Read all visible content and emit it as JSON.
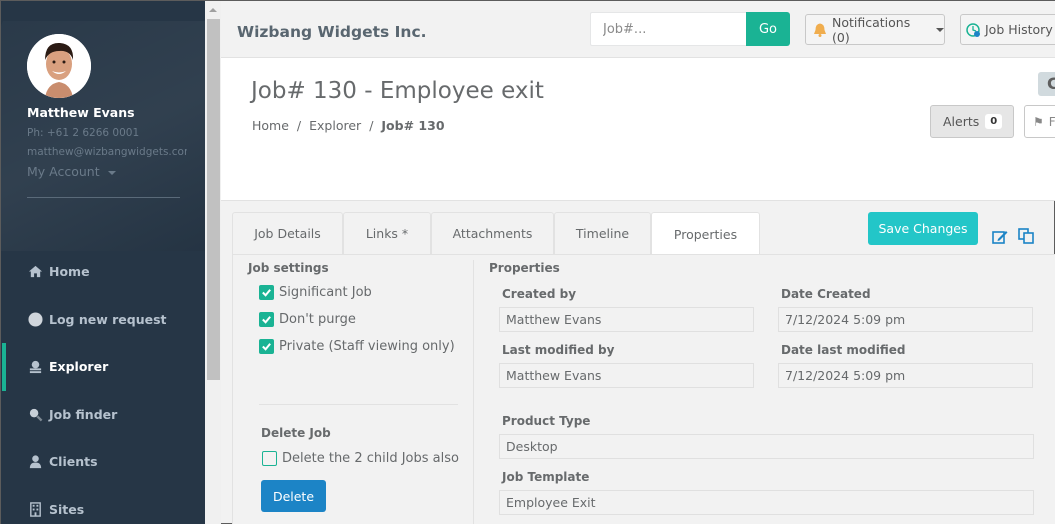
{
  "user": {
    "name": "Matthew Evans",
    "phone": "Ph: +61 2 6266 0001",
    "email": "matthew@wizbangwidgets.com",
    "account_menu": "My Account"
  },
  "sidebar": {
    "items": [
      {
        "label": "Home",
        "icon": "home-icon"
      },
      {
        "label": "Log new request",
        "icon": "circle-icon"
      },
      {
        "label": "Explorer",
        "icon": "explorer-icon",
        "active": true
      },
      {
        "label": "Job finder",
        "icon": "search-icon"
      },
      {
        "label": "Clients",
        "icon": "user-icon"
      },
      {
        "label": "Sites",
        "icon": "building-icon"
      }
    ]
  },
  "topbar": {
    "brand": "Wizbang Widgets Inc.",
    "search_placeholder": "Job#...",
    "search_value": "",
    "go_label": "Go",
    "notifications_label": "Notifications (0)",
    "job_history_label": "Job History"
  },
  "header": {
    "title": "Job# 130 - Employee exit",
    "breadcrumb": [
      "Home",
      "Explorer",
      "Job# 130"
    ],
    "status_chip": "C",
    "alerts_label": "Alerts",
    "alerts_count": "0",
    "filter_label": "F"
  },
  "tabs": [
    {
      "label": "Job Details"
    },
    {
      "label": "Links *"
    },
    {
      "label": "Attachments"
    },
    {
      "label": "Timeline"
    },
    {
      "label": "Properties",
      "active": true
    }
  ],
  "actions": {
    "save_label": "Save Changes"
  },
  "job_settings": {
    "heading": "Job settings",
    "options": [
      {
        "label": "Significant Job",
        "checked": true
      },
      {
        "label": "Don't purge",
        "checked": true
      },
      {
        "label": "Private (Staff viewing only)",
        "checked": true
      }
    ]
  },
  "delete_job": {
    "heading": "Delete Job",
    "child_option": {
      "label": "Delete the 2 child Jobs also",
      "checked": false
    },
    "button_label": "Delete"
  },
  "properties": {
    "heading": "Properties",
    "created_by_label": "Created by",
    "created_by": "Matthew Evans",
    "date_created_label": "Date Created",
    "date_created": "7/12/2024 5:09 pm",
    "last_modified_by_label": "Last modified by",
    "last_modified_by": "Matthew Evans",
    "date_last_modified_label": "Date last modified",
    "date_last_modified": "7/12/2024 5:09 pm",
    "product_type_label": "Product Type",
    "product_type": "Desktop",
    "job_template_label": "Job Template",
    "job_template": "Employee Exit"
  },
  "colors": {
    "sidebar_bg": "#263646",
    "accent_green": "#1ab394",
    "save_teal": "#23c6c8",
    "delete_blue": "#1c84c6"
  }
}
